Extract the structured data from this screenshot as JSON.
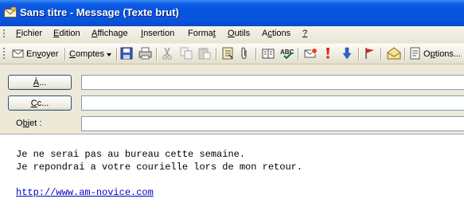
{
  "window": {
    "title": "Sans titre - Message (Texte brut)",
    "icon": "envelope-icon"
  },
  "menubar": {
    "items": [
      {
        "pre": "",
        "key": "F",
        "post": "ichier"
      },
      {
        "pre": "",
        "key": "E",
        "post": "dition"
      },
      {
        "pre": "",
        "key": "A",
        "post": "ffichage"
      },
      {
        "pre": "",
        "key": "I",
        "post": "nsertion"
      },
      {
        "pre": "Forma",
        "key": "t",
        "post": ""
      },
      {
        "pre": "",
        "key": "O",
        "post": "utils"
      },
      {
        "pre": "A",
        "key": "c",
        "post": "tions"
      },
      {
        "pre": "",
        "key": "?",
        "post": ""
      }
    ]
  },
  "toolbar": {
    "send": {
      "pre": "En",
      "key": "v",
      "post": "oyer"
    },
    "accounts": {
      "pre": "",
      "key": "C",
      "post": "omptes"
    },
    "options": {
      "pre": "O",
      "key": "p",
      "post": "tions..."
    }
  },
  "header": {
    "to_button": {
      "pre": "",
      "key": "À",
      "post": "..."
    },
    "cc_button": {
      "pre": "",
      "key": "C",
      "post": "c..."
    },
    "subject_label": {
      "pre": "O",
      "key": "b",
      "post": "jet :"
    },
    "to_value": "",
    "cc_value": "",
    "subject_value": ""
  },
  "body": {
    "line1": "Je ne serai pas au bureau cette semaine.",
    "line2": "Je repondrai a votre courielle lors de mon retour.",
    "link": "http://www.am-novice.com"
  },
  "colors": {
    "titlebar": "#0a55de",
    "link": "#0000c0",
    "chrome": "#ece9d8"
  }
}
